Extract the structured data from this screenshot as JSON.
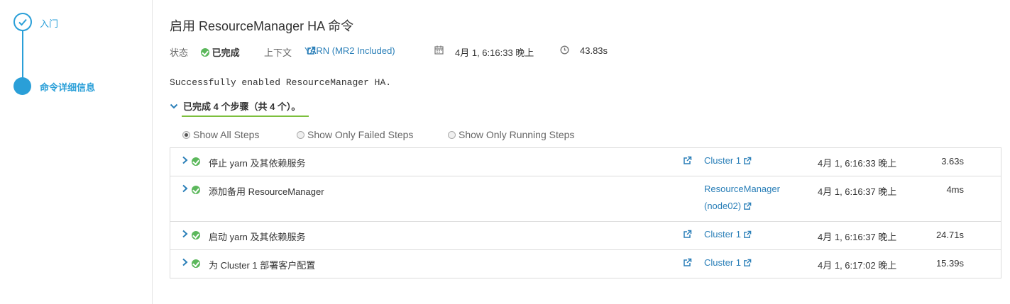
{
  "wizard": {
    "steps": [
      {
        "label": "入门",
        "state": "done"
      },
      {
        "label": "命令详细信息",
        "state": "current"
      }
    ]
  },
  "command": {
    "title": "启用 ResourceManager HA 命令",
    "status_label": "状态",
    "status_value": "已完成",
    "context_label": "上下文",
    "context_link": "YARN (MR2 Included)",
    "start_time": "4月 1, 6:16:33 晚上",
    "duration": "43.83s",
    "message": "Successfully enabled ResourceManager HA.",
    "summary": "已完成 4 个步骤（共 4 个）。"
  },
  "filters": {
    "options": [
      "Show All Steps",
      "Show Only Failed Steps",
      "Show Only Running Steps"
    ],
    "selected": "Show All Steps"
  },
  "steps": [
    {
      "name": "停止 yarn 及其依赖服务",
      "context": "Cluster 1",
      "time": "4月 1, 6:16:33 晚上",
      "duration": "3.63s"
    },
    {
      "name": "添加备用 ResourceManager",
      "context": "ResourceManager (node02)",
      "context_line1": "ResourceManager",
      "context_line2": "(node02)",
      "time": "4月 1, 6:16:37 晚上",
      "duration": "4ms"
    },
    {
      "name": "启动 yarn 及其依赖服务",
      "context": "Cluster 1",
      "time": "4月 1, 6:16:37 晚上",
      "duration": "24.71s"
    },
    {
      "name": "为 Cluster 1 部署客户配置",
      "context": "Cluster 1",
      "time": "4月 1, 6:17:02 晚上",
      "duration": "15.39s"
    }
  ],
  "colors": {
    "accent": "#2a9fd8",
    "link": "#2a7fb8",
    "success": "#5cb85c",
    "underline": "#7cbf3d"
  }
}
